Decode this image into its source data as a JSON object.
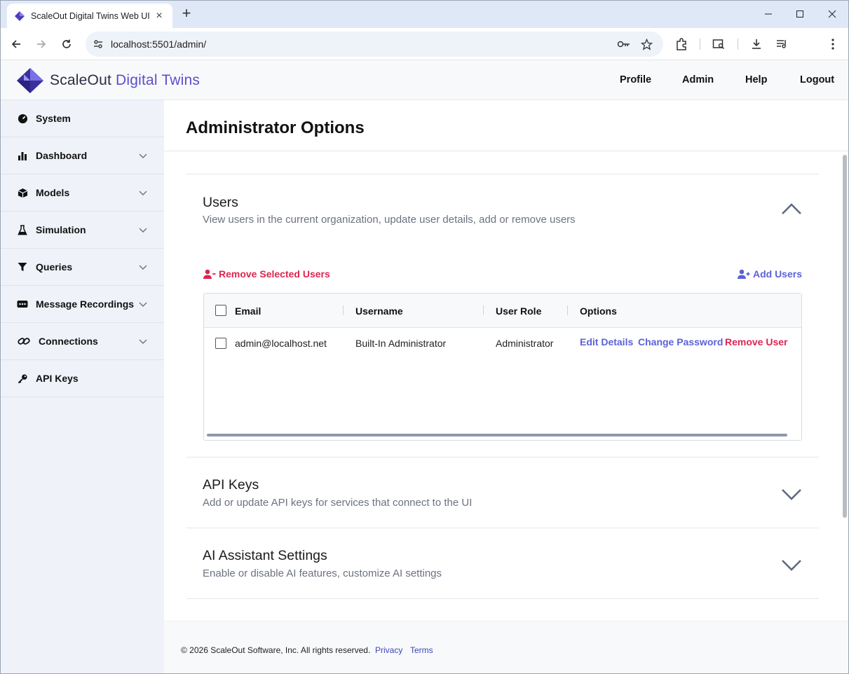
{
  "browser": {
    "tab_title": "ScaleOut Digital Twins Web UI",
    "url": "localhost:5501/admin/",
    "new_tab_icon": "plus-icon",
    "window_controls": [
      "minimize-icon",
      "maximize-icon",
      "close-icon"
    ]
  },
  "header": {
    "brand_primary": "ScaleOut",
    "brand_accent": "Digital Twins",
    "nav": [
      "Profile",
      "Admin",
      "Help",
      "Logout"
    ]
  },
  "sidebar": {
    "items": [
      {
        "label": "System",
        "icon": "dashboard-gauge-icon",
        "expandable": false
      },
      {
        "label": "Dashboard",
        "icon": "bar-chart-icon",
        "expandable": true
      },
      {
        "label": "Models",
        "icon": "cube-icon",
        "expandable": true
      },
      {
        "label": "Simulation",
        "icon": "flask-icon",
        "expandable": true
      },
      {
        "label": "Queries",
        "icon": "filter-icon",
        "expandable": true
      },
      {
        "label": "Message Recordings",
        "icon": "message-icon",
        "expandable": true
      },
      {
        "label": "Connections",
        "icon": "link-icon",
        "expandable": true
      },
      {
        "label": "API Keys",
        "icon": "key-icon",
        "expandable": false
      }
    ]
  },
  "main": {
    "title": "Administrator Options",
    "sections": [
      {
        "title": "Users",
        "description": "View users in the current organization, update user details, add or remove users",
        "expanded": true
      },
      {
        "title": "API Keys",
        "description": "Add or update API keys for services that connect to the UI",
        "expanded": false
      },
      {
        "title": "AI Assistant Settings",
        "description": "Enable or disable AI features, customize AI settings",
        "expanded": false
      }
    ],
    "users": {
      "remove_selected_label": "Remove Selected Users",
      "add_users_label": "Add Users",
      "columns": [
        "Email",
        "Username",
        "User Role",
        "Options"
      ],
      "rows": [
        {
          "email": "admin@localhost.net",
          "username": "Built-In Administrator",
          "role": "Administrator",
          "actions": [
            "Edit Details",
            "Change Password",
            "Remove User"
          ]
        }
      ]
    }
  },
  "footer": {
    "copyright": "© 2026 ScaleOut Software, Inc. All rights reserved.",
    "links": [
      "Privacy",
      "Terms"
    ]
  },
  "colors": {
    "accent": "#5b62d6",
    "danger": "#dc2650",
    "sidebar_bg": "#eff2f8",
    "tabstrip_bg": "#dfe8f7"
  }
}
